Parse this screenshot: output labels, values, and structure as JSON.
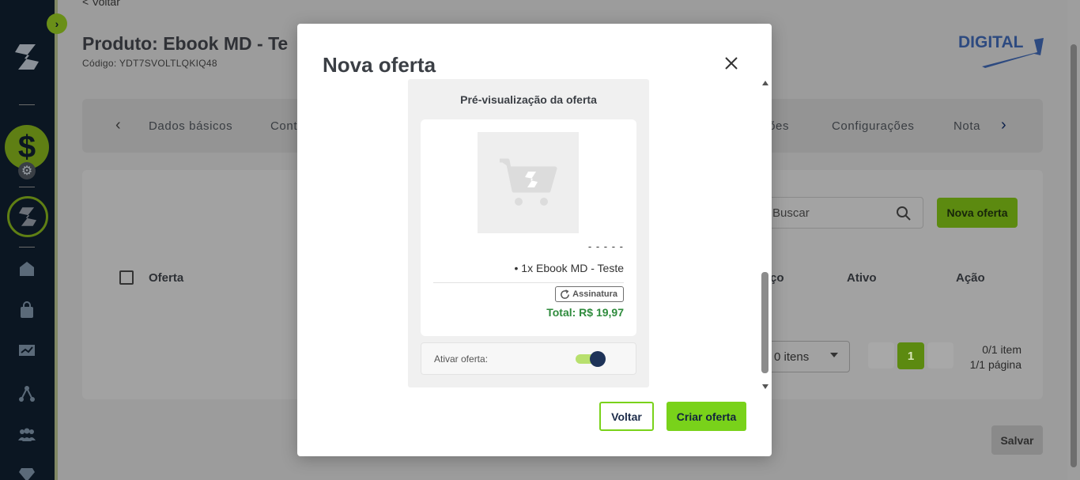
{
  "colors": {
    "accent": "#79d21a",
    "sidebar": "#0b1622",
    "total": "#2e8b3c",
    "switch_knob": "#1e3358"
  },
  "page": {
    "back_link": "< Voltar",
    "product_title": "Produto: Ebook MD - Te",
    "product_code": "Código: YDT7SVOLTLQKIQ48",
    "brand": "DIGITAL",
    "tabs": [
      "Dados básicos",
      "Cont",
      "ções",
      "Configurações",
      "Nota"
    ],
    "search_placeholder": "Buscar",
    "new_offer_label": "Nova oferta",
    "columns": {
      "offer": "Oferta",
      "price": "ço",
      "active": "Ativo",
      "action": "Ação"
    },
    "per_page_label": "0 itens",
    "current_page": "1",
    "items_info": "0/1 item",
    "pages_info": "1/1 página",
    "save_label": "Salvar"
  },
  "modal": {
    "title": "Nova oferta",
    "preview": {
      "title": "Pré-visualização da oferta",
      "dashes": "- - - - -",
      "item_line": "• 1x Ebook MD - Teste",
      "badge_label": "Assinatura",
      "total": "Total: R$ 19,97",
      "activate_label": "Ativar oferta:",
      "activate_on": true
    },
    "back_button": "Voltar",
    "create_button": "Criar oferta"
  }
}
